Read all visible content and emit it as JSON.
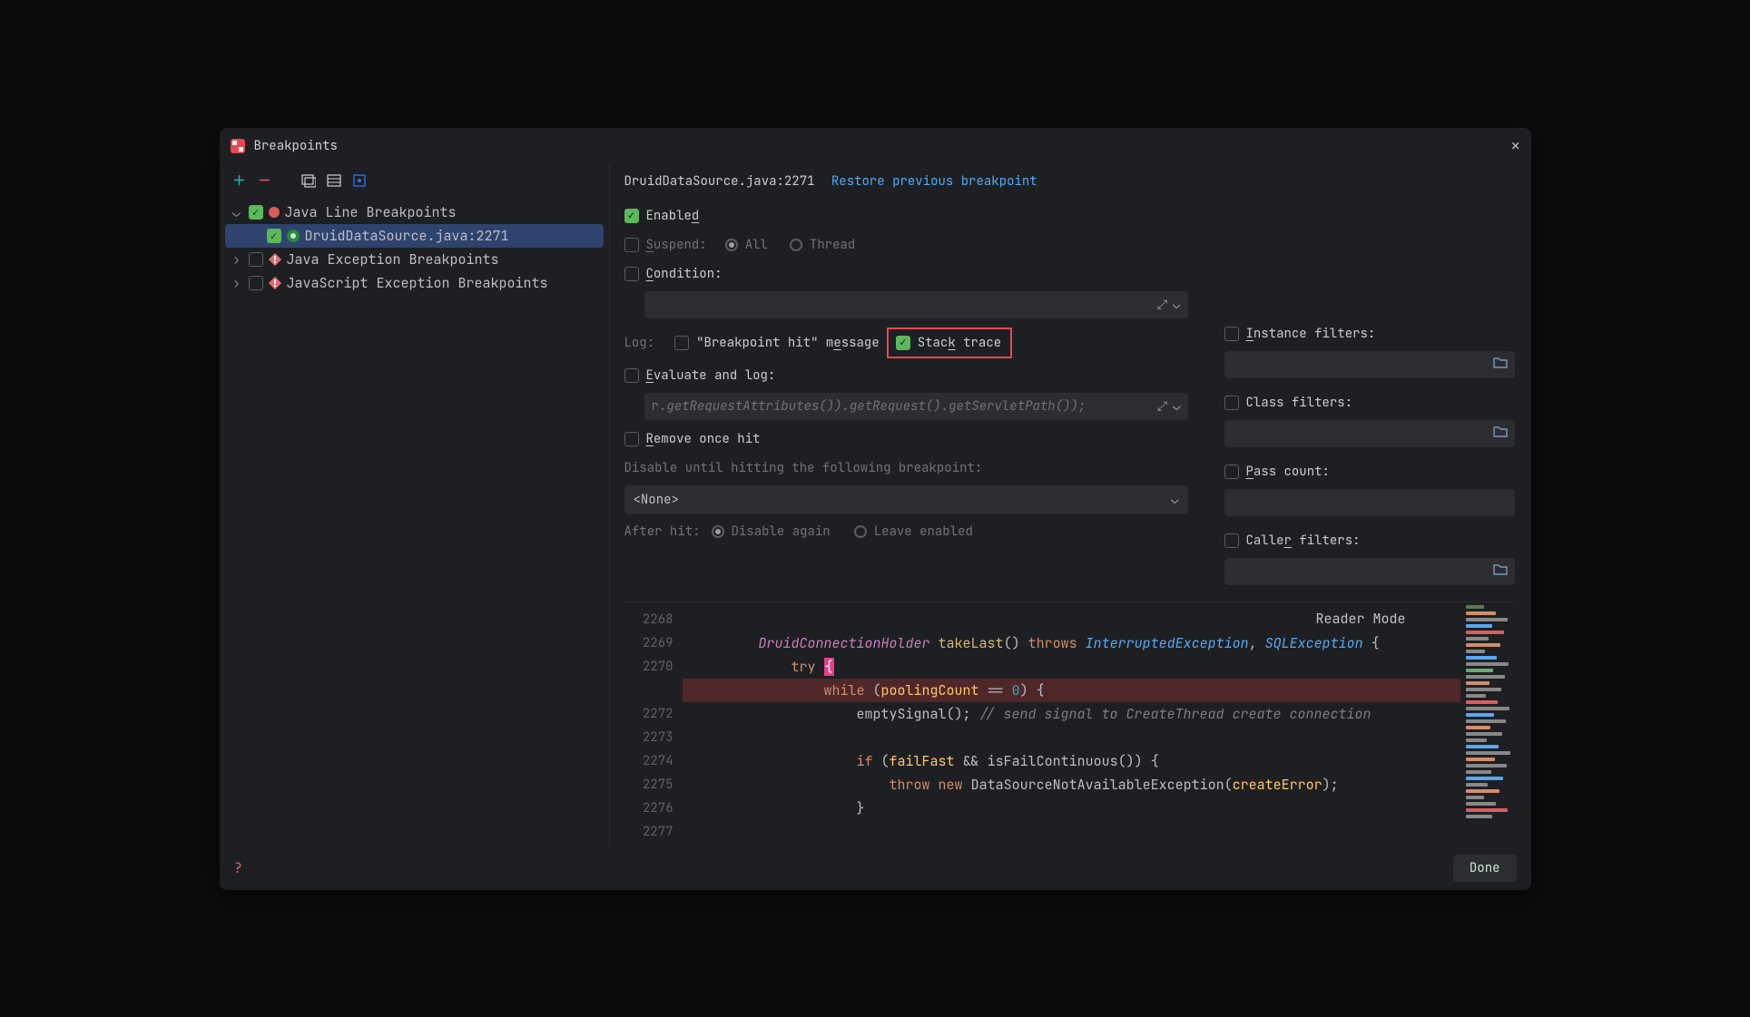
{
  "dialog": {
    "title": "Breakpoints"
  },
  "leftToolbar": {
    "icons": [
      "add",
      "remove",
      "sep",
      "group-by-file",
      "group-by-class",
      "view-options"
    ]
  },
  "tree": {
    "groups": [
      {
        "label": "Java Line Breakpoints",
        "expanded": true,
        "checked": true,
        "iconColor": "#db5c5c",
        "iconShape": "circle",
        "items": [
          {
            "label": "DruidDataSource.java:2271",
            "checked": true,
            "selected": true,
            "iconType": "bp-green"
          }
        ]
      },
      {
        "label": "Java Exception Breakpoints",
        "expanded": false,
        "checked": false,
        "iconColor": "#e06c75",
        "iconShape": "diamond"
      },
      {
        "label": "JavaScript Exception Breakpoints",
        "expanded": false,
        "checked": false,
        "iconColor": "#e06c75",
        "iconShape": "diamond"
      }
    ]
  },
  "detail": {
    "fileRef": "DruidDataSource.java:2271",
    "restore": "Restore previous breakpoint",
    "enabled": {
      "checked": true,
      "label": "Enable",
      "labelU": "d"
    },
    "suspend": {
      "checked": false,
      "label": "uspend:",
      "labelU": "S",
      "options": [
        {
          "label": "All",
          "sel": true
        },
        {
          "label": "Thread",
          "sel": false
        }
      ]
    },
    "condition": {
      "checked": false,
      "label": "ondition:",
      "labelU": "C",
      "value": ""
    },
    "logLabel": "Log:",
    "logHit": {
      "checked": false,
      "label": "\"Breakpoint hit\" m",
      "labelU": "e",
      "labelTail": "ssage"
    },
    "stackTrace": {
      "checked": true,
      "label": "Stac",
      "labelU": "k",
      "labelTail": " trace"
    },
    "evalLog": {
      "checked": false,
      "label": "valuate and log:",
      "labelU": "E",
      "value_pre": "r.",
      "value_code": "getRequestAttributes()).getRequest().getServletPath());"
    },
    "removeOnce": {
      "checked": false,
      "labelU": "R",
      "label": "emove once hit"
    },
    "disableUntil": "Disable until hitting the following breakpoint:",
    "disableSelect": "<None>",
    "afterHit": {
      "label": "After hit:",
      "options": [
        {
          "label": "Disable again",
          "sel": true
        },
        {
          "label": "Leave enabled",
          "sel": false
        }
      ]
    },
    "filters": {
      "instance": {
        "checked": false,
        "label": "nstance filters:",
        "labelU": "I"
      },
      "class": {
        "checked": false,
        "label": "Class filters:",
        "labelU": ""
      },
      "pass": {
        "checked": false,
        "labelU": "P",
        "label": "ass count:"
      },
      "caller": {
        "checked": false,
        "label": "Calle",
        "labelU": "r",
        "labelTail": " filters:"
      }
    }
  },
  "code": {
    "readerMode": "Reader Mode",
    "lines": [
      {
        "n": 2268,
        "html": ""
      },
      {
        "n": 2269,
        "html": "    <span class='type'>DruidConnectionHolder</span> <span class='fn'>takeLast</span>() <span class='kw'>throws</span> <span class='type2'>InterruptedException</span><span class='op'>,</span> <span class='type2'>SQLException </span><span class='op'>{</span>"
      },
      {
        "n": 2270,
        "html": "        <span class='kw'>try</span> <span class='brace-hl'>{</span>",
        "brace": "{"
      },
      {
        "n": "bp",
        "html": "            <span class='kw'>while</span> (<span class='param'>poolingCount</span> <span class='op'>==</span> <span class='num'>0</span>) {"
      },
      {
        "n": 2272,
        "html": "                <span class='fn2'>emptySignal</span>(); <span class='comm'>// send signal to CreateThread create connection</span>"
      },
      {
        "n": 2273,
        "html": ""
      },
      {
        "n": 2274,
        "html": "                <span class='kw'>if</span> (<span class='param'>failFast</span> <span class='op'>&amp;&amp;</span> <span class='fn2'>isFailContinuous</span>()) {"
      },
      {
        "n": 2275,
        "html": "                    <span class='kw'>throw</span> <span class='kw'>new</span> <span class='fn2'>DataSourceNotAvailableException</span>(<span class='param'>createError</span>);"
      },
      {
        "n": 2276,
        "html": "                }"
      },
      {
        "n": 2277,
        "html": ""
      }
    ]
  },
  "footer": {
    "done": "Done"
  },
  "colors": {
    "highlightBox": "#e8474d",
    "accentGreen": "#5bb95a"
  }
}
